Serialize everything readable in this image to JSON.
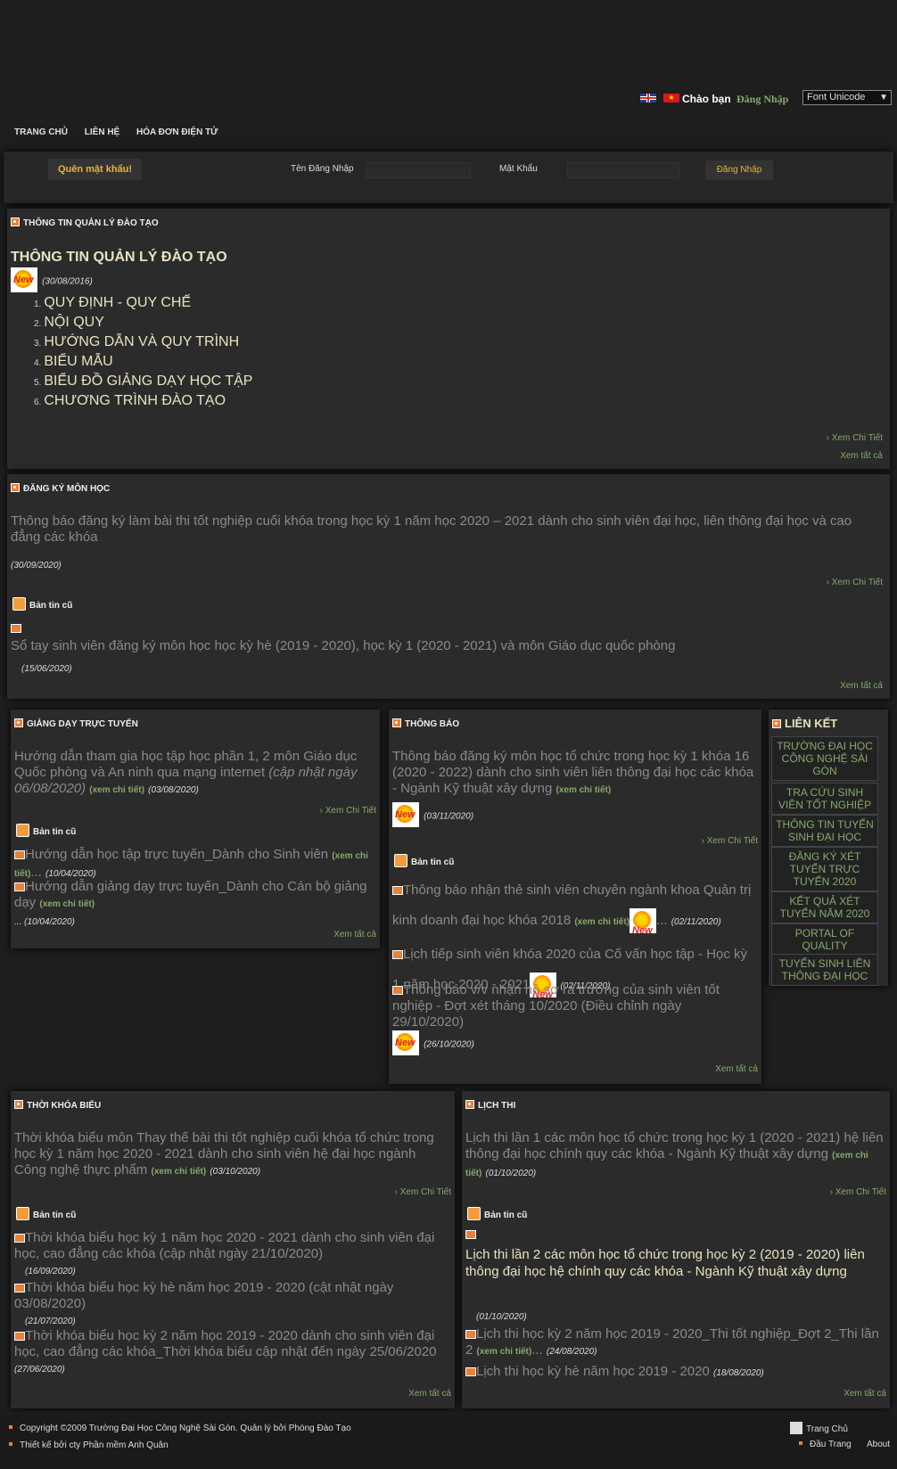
{
  "top": {
    "greeting": "Chào bạn",
    "login_link": "Đăng Nhập",
    "font_select": "Font Unicode"
  },
  "nav": [
    "TRANG CHỦ",
    "LIÊN HỆ",
    "HÓA ĐƠN ĐIỆN TỬ"
  ],
  "login": {
    "forgot": "Quên mật khẩu!",
    "username_label": "Tên Đăng Nhập",
    "password_label": "Mật Khẩu",
    "submit": "Đăng Nhập"
  },
  "common": {
    "detail": "Xem Chi Tiết",
    "all": "Xem tất cả",
    "old": "Bản tin cũ",
    "see_detail": "(xem chi tiết)"
  },
  "training": {
    "title": "THÔNG TIN QUẢN LÝ ĐÀO TẠO",
    "heading": "THÔNG TIN QUẢN LÝ ĐÀO TẠO",
    "date": "(30/08/2016)",
    "items": [
      "QUY ĐỊNH - QUY CHẾ",
      "NỘI QUY",
      "HƯỚNG DẪN VÀ QUY TRÌNH",
      "BIỂU MẪU",
      "BIỂU ĐỒ GIẢNG DẠY HỌC TẬP",
      "CHƯƠNG TRÌNH ĐÀO TẠO"
    ]
  },
  "register": {
    "title": "ĐĂNG KÝ MÔN HỌC",
    "main": "Thông báo đăng ký làm bài thi tốt nghiệp cuối khóa trong học kỳ 1 năm học 2020 – 2021 dành cho sinh viên đại học, liên thông đại học và cao đẳng các khóa",
    "main_date": "(30/09/2020)",
    "old_item": "Sổ tay sinh viên đăng ký môn học học kỳ hè (2019 - 2020), học kỳ 1 (2020 - 2021) và môn Giáo dục quốc phòng",
    "old_date": "(15/06/2020)"
  },
  "online": {
    "title": "GIẢNG DẠY TRỰC TUYẾN",
    "main": "Hướng dẫn tham gia học tập học phần 1, 2 môn Giáo dục Quốc phòng và An ninh qua mạng internet",
    "main_note": "(cập nhật ngày 06/08/2020)",
    "main_date": "(03/08/2020)",
    "old": [
      {
        "text": "Hướng dẫn học tập trực tuyến_Dành cho Sinh viên",
        "date": "(10/04/2020)"
      },
      {
        "text": "Hướng dẫn giảng dạy trực tuyến_Dành cho Cán bộ giảng dạy",
        "date": "(10/04/2020)"
      }
    ]
  },
  "notice": {
    "title": "THÔNG BÁO",
    "main": "Thông báo đăng ký môn học tổ chức trong học kỳ 1 khóa 16 (2020 - 2022) dành cho sinh viên liên thông đại học các khóa - Ngành Kỹ thuật xây dựng",
    "main_date": "(03/11/2020)",
    "old": [
      {
        "text": "Thông báo nhận thẻ sinh viên chuyên ngành khoa Quản trị kinh doanh đại học khóa 2018",
        "date": "(02/11/2020)"
      },
      {
        "text": "Lịch tiếp sinh viên khóa 2020 của Cố vấn học tập - Học kỳ 1 năm học 2020 - 2021",
        "date": "(02/11/2020)"
      },
      {
        "text": "Thông báo v/v nhận hồ sơ ra trường của sinh viên tốt nghiệp - Đợt xét tháng 10/2020 (Điều chỉnh ngày 29/10/2020)",
        "date": "(26/10/2020)"
      }
    ]
  },
  "links": {
    "title": "LIÊN KẾT",
    "items": [
      "TRƯỜNG ĐẠI HỌC CÔNG NGHỆ SÀI GÒN",
      "TRA CỨU SINH VIÊN TỐT NGHIỆP",
      "THÔNG TIN TUYỂN SINH ĐẠI HỌC",
      "ĐĂNG KÝ XÉT TUYỂN TRỰC TUYẾN 2020",
      "KẾT QUẢ XÉT TUYỂN NĂM 2020",
      "PORTAL OF QUALITY VERIFICATION",
      "TUYỂN SINH LIÊN THÔNG ĐẠI HỌC"
    ]
  },
  "timetable": {
    "title": "THỜI KHÓA BIỂU",
    "main": "Thời khóa biểu môn Thay thế bài thi tốt nghiệp cuối khóa tổ chức trong học kỳ 1 năm học 2020 - 2021 dành cho sinh viên hệ đại học ngành Công nghệ thực phẩm",
    "main_date": "(03/10/2020)",
    "old": [
      {
        "text": "Thời khóa biểu học kỳ 1 năm học 2020 - 2021 dành cho sinh viên đại học, cao đẳng các khóa (cập nhật ngày 21/10/2020)",
        "date": "(16/09/2020)"
      },
      {
        "text": "Thời khóa biểu học kỳ hè năm học 2019 - 2020 (cật nhật ngày 03/08/2020)",
        "date": "(21/07/2020)"
      },
      {
        "text": "Thời khóa biểu học kỳ 2 năm học 2019 - 2020 dành cho sinh viên đại học, cao đẳng các khóa_Thời khóa biểu cập nhật đến ngày 25/06/2020",
        "date": "(27/06/2020)"
      }
    ]
  },
  "exam": {
    "title": "LỊCH THI",
    "main": "Lịch thi lần 1 các môn học tổ chức trong học kỳ 1 (2020 - 2021) hệ liên thông đại học chính quy các khóa - Ngành Kỹ thuật xây dựng",
    "main_date": "(01/10/2020)",
    "old": [
      {
        "text": "Lịch thi lần 2 các môn học tổ chức trong học kỳ 2 (2019 - 2020) liên thông đại học hệ chính quy các khóa - Ngành Kỹ thuật xây dựng",
        "date": "(01/10/2020)"
      },
      {
        "text": "Lịch thi học kỳ 2 năm học 2019 - 2020_Thi tốt nghiệp_Đợt 2_Thi lần 2",
        "date": "(24/08/2020)"
      },
      {
        "text": "Lịch thi học kỳ hè năm học 2019 - 2020",
        "date": "(18/08/2020)"
      }
    ]
  },
  "footer": {
    "copyright": "Copyright ©2009 Trường Đại Học Công Nghệ Sài Gòn. Quản lý bởi Phòng Đào Tạo",
    "designer": "Thiết kế bởi cty Phần mềm Anh Quân",
    "home": "Trang Chủ",
    "top": "Đầu Trang",
    "about": "About"
  }
}
